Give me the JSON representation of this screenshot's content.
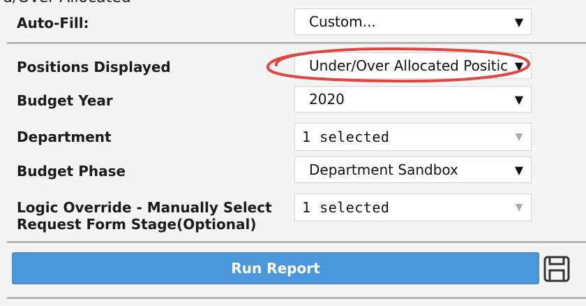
{
  "header_fragment": "d/Over Allocated",
  "form": {
    "auto_fill": {
      "label": "Auto-Fill:",
      "value": "Custom..."
    },
    "positions_displayed": {
      "label": "Positions Displayed",
      "value": "Under/Over Allocated Positic"
    },
    "budget_year": {
      "label": "Budget Year",
      "value": "2020"
    },
    "department": {
      "label": "Department",
      "value": "1 selected"
    },
    "budget_phase": {
      "label": "Budget Phase",
      "value": "Department Sandbox"
    },
    "logic_override": {
      "label_line1": "Logic Override - Manually Select",
      "label_line2": "Request Form Stage(Optional)",
      "value": "1 selected"
    }
  },
  "run_button_label": "Run Report",
  "icons": {
    "caret": "▼",
    "caret_light": "▼",
    "save": "save-icon"
  },
  "colors": {
    "run_button": "#4a97db",
    "highlight": "#e0463f"
  }
}
